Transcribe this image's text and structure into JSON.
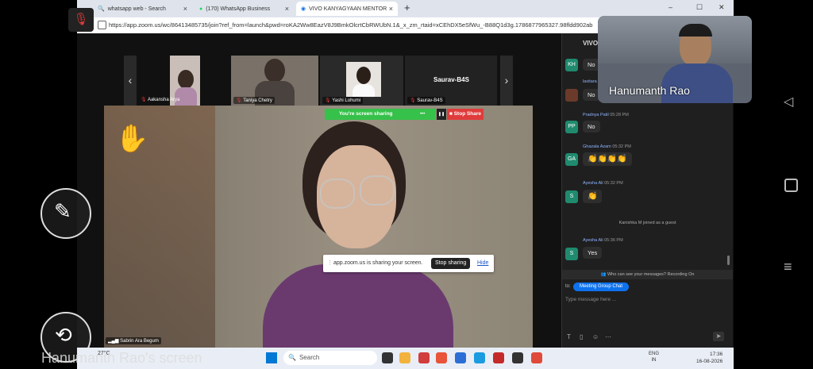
{
  "browser": {
    "tabs": [
      {
        "label": "whatsapp web - Search",
        "active": false
      },
      {
        "label": "(170) WhatsApp Business",
        "active": false
      },
      {
        "label": "VIVO KANYAGYAAN MENTOR",
        "active": true
      }
    ],
    "new_tab": "+",
    "close_glyph": "×",
    "window_controls": [
      "–",
      "☐",
      "✕"
    ],
    "url": "https://app.zoom.us/wc/86413485735/join?ref_from=launch&pwd=roKA2Ww8EazV8J9BmkOlcrtCbRWUbN.1&_x_zm_rtaid=xCEhDX5eSfWu_-B88Q1d3g.1786877965327.98fldd902ab"
  },
  "participants": [
    {
      "name": "Aakansha Arya"
    },
    {
      "name": "Taniya Chetry"
    },
    {
      "name": "Yashi Lohumi"
    },
    {
      "name": "Saurav-B4S"
    }
  ],
  "tile_label": "Saurav-B4S",
  "main_speaker": {
    "name": "Sabrin Ara Begum"
  },
  "share": {
    "bar_label": "You're screen sharing",
    "more": "•••",
    "pause": "❚❚",
    "stop_label": "Stop Share",
    "popup_text": "app.zoom.us is sharing your screen.",
    "popup_stop": "Stop sharing",
    "popup_hide": "Hide"
  },
  "raise_hand_icon": "✋",
  "arrows": {
    "left": "‹",
    "right": "›"
  },
  "chat": {
    "title": "VIVO",
    "messages": [
      {
        "initials": "KH",
        "color": "#1f8a6e",
        "sender": "",
        "time": "",
        "text": "No"
      },
      {
        "initials": "",
        "color": "#6b3a2a",
        "sender": "laxitara",
        "time": "",
        "text": "No"
      },
      {
        "initials": "PP",
        "color": "#1f8a6e",
        "sender": "Pradnya Patil",
        "time": "05:28 PM",
        "text": "No"
      },
      {
        "initials": "GA",
        "color": "#1f8a6e",
        "sender": "Ghazala Azam",
        "time": "05:32 PM",
        "text": "👏👏👏👏"
      },
      {
        "initials": "S",
        "color": "#1f8a6e",
        "sender": "Ayesha Ali",
        "time": "05:32 PM",
        "text": "👏"
      },
      {
        "initials": "S",
        "color": "#1f8a6e",
        "sender": "Ayesha Ali",
        "time": "05:36 PM",
        "text": "Yes"
      }
    ],
    "system_note": "Kanishka M joined as a guest",
    "privacy_note": "Who can see your messages? Recording On",
    "to_label": "to:",
    "recipient": "Meeting Group Chat",
    "input_placeholder": "Type message here ..."
  },
  "self_view": {
    "name": "Hanumanth Rao"
  },
  "caption": "Hanumanth Rao's screen",
  "taskbar": {
    "weather": "27°C",
    "search_placeholder": "Search",
    "language": "ENG",
    "region": "IN",
    "time": "17:36",
    "date": "16-08-2026"
  },
  "android_nav": {
    "back": "◁",
    "home": "○",
    "menu": "≡"
  },
  "colors": {
    "share_green": "#36c14a",
    "stop_red": "#e03b3b",
    "zoom_blue": "#0e72ed"
  }
}
